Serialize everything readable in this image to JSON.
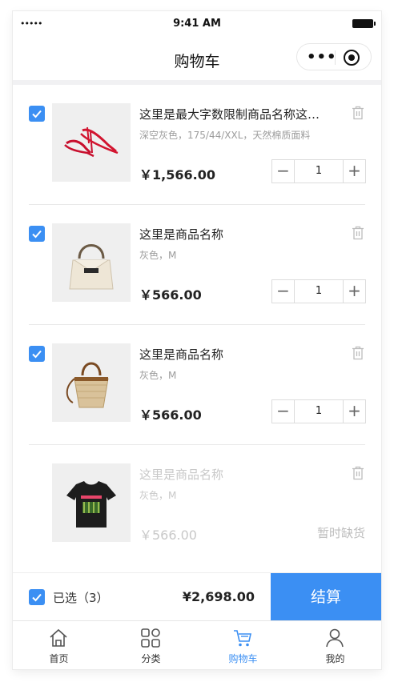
{
  "status_bar": {
    "signal": "•••••",
    "time": "9:41 AM"
  },
  "nav": {
    "title": "购物车",
    "more_icon": "more-dots-icon",
    "target_icon": "target-icon"
  },
  "items": [
    {
      "name": "这里是最大字数限制商品名称这里是最大字数限制商品名称",
      "spec": "深空灰色，175/44/XXL，天然棉质面料",
      "price": "￥1,566.00",
      "qty": "1",
      "checked": true,
      "available": true,
      "image": "red-sandals"
    },
    {
      "name": "这里是商品名称",
      "spec": "灰色，M",
      "price": "￥566.00",
      "qty": "1",
      "checked": true,
      "available": true,
      "image": "white-handbag"
    },
    {
      "name": "这里是商品名称",
      "spec": "灰色，M",
      "price": "￥566.00",
      "qty": "1",
      "checked": true,
      "available": true,
      "image": "straw-bag"
    },
    {
      "name": "这里是商品名称",
      "spec": "灰色，M",
      "price": "￥566.00",
      "checked": false,
      "available": false,
      "status": "暂时缺货",
      "image": "black-tshirt"
    }
  ],
  "checkout": {
    "selected_label": "已选（3）",
    "total": "¥2,698.00",
    "button": "结算"
  },
  "tabs": [
    {
      "label": "首页",
      "icon": "home-icon"
    },
    {
      "label": "分类",
      "icon": "category-icon"
    },
    {
      "label": "购物车",
      "icon": "cart-icon",
      "active": true
    },
    {
      "label": "我的",
      "icon": "profile-icon"
    }
  ],
  "colors": {
    "accent": "#3b8ff3",
    "muted": "#9c9c9c",
    "disabled": "#c8c8c8"
  }
}
